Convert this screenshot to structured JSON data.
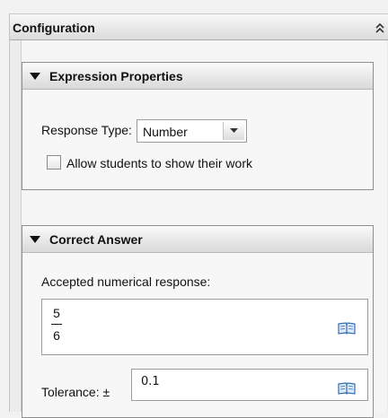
{
  "panel": {
    "title": "Configuration"
  },
  "expression_properties": {
    "title": "Expression Properties",
    "response_type_label": "Response Type:",
    "response_type_value": "Number",
    "allow_work_label": "Allow students to show their work",
    "allow_work_checked": false
  },
  "correct_answer": {
    "title": "Correct Answer",
    "accepted_label": "Accepted numerical response:",
    "answer_numerator": "5",
    "answer_denominator": "6",
    "tolerance_label": "Tolerance: ±",
    "tolerance_value": "0.1"
  },
  "icons": {
    "collapse": "double-chevron-up-icon",
    "section_toggle": "triangle-down-icon",
    "dropdown": "chevron-down-icon",
    "math_template": "book-icon"
  },
  "colors": {
    "panel_bg": "#ececec",
    "section_border": "#8f8f8f",
    "icon_blue": "#2f6fb5"
  }
}
